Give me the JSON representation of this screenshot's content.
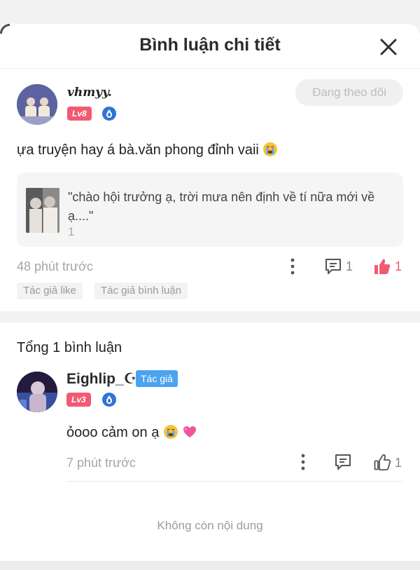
{
  "header": {
    "title": "Bình luận chi tiết"
  },
  "comment": {
    "username": "vhmyy.",
    "level": "Lv8",
    "follow_label": "Đang theo dõi",
    "text": "ựa truyện hay á bà.văn phong đỉnh vaii",
    "quote": {
      "text": "\"chào hội trưởng ạ, trời mưa nên định về tí nữa mới về ạ....\"",
      "count": "1"
    },
    "time": "48 phút trước",
    "reply_count": "1",
    "like_count": "1",
    "tags": [
      "Tác giả like",
      "Tác giả bình luận"
    ]
  },
  "total_label": "Tổng 1 bình luận",
  "reply": {
    "username": "Eighlip_☪",
    "author_tag": "Tác giả",
    "level": "Lv3",
    "text": "ỏooo cảm on ạ",
    "time": "7 phút trước",
    "like_count": "1"
  },
  "end_text": "Không còn nội dung",
  "colors": {
    "accent": "#f25a73",
    "author_tag": "#4ba3f0",
    "level_badge": "#f25a73"
  }
}
